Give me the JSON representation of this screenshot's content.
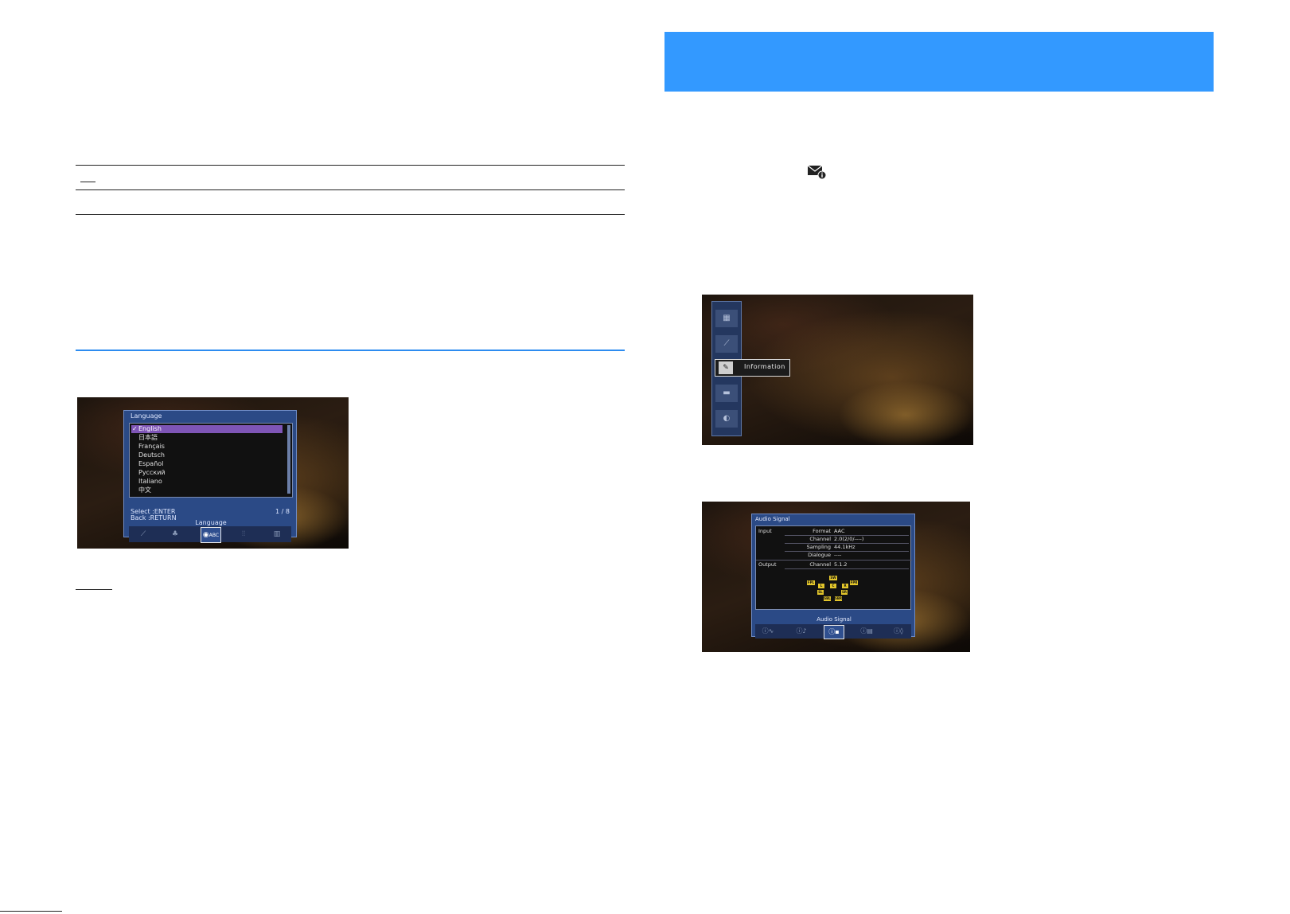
{
  "language_screen": {
    "title": "Language",
    "items": [
      "English",
      "日本語",
      "Français",
      "Deutsch",
      "Español",
      "Русский",
      "Italiano",
      "中文"
    ],
    "selected_index": 0,
    "select_hint": "Select :ENTER",
    "back_hint": "Back :RETURN",
    "page_indicator": "1 / 8",
    "section_label": "Language",
    "icons": [
      "wrench-icon",
      "plant-icon",
      "globe-abc-icon",
      "equalizer-icon",
      "grid-icon"
    ],
    "selected_icon_label": "ABC"
  },
  "info_menu_screen": {
    "popup_label": "Information",
    "icons": [
      "input-icon",
      "guitar-icon",
      "information-icon",
      "speaker-icon",
      "disc-icon"
    ]
  },
  "audio_signal_screen": {
    "title": "Audio Signal",
    "input_label": "Input",
    "output_label": "Output",
    "rows": [
      {
        "field": "Format",
        "value": "AAC"
      },
      {
        "field": "Channel",
        "value": "2.0(2/0/----)"
      },
      {
        "field": "Sampling",
        "value": "44.1kHz"
      },
      {
        "field": "Dialogue",
        "value": "----"
      }
    ],
    "output_row": {
      "field": "Channel",
      "value": "5.1.2"
    },
    "speakers": [
      "FPL",
      "SW",
      "FPR",
      "L",
      "C",
      "R",
      "SL",
      "SR",
      "SBL",
      "SBR"
    ],
    "footer_label": "Audio Signal",
    "icons": [
      "info-input-icon",
      "info-dsp-icon",
      "info-audio-icon",
      "info-video-icon",
      "info-zone-icon"
    ]
  },
  "colors": {
    "header_bar": "#3399ff",
    "blue_rule": "#2d8cf0",
    "dialog_blue": "#2b4a86",
    "selected_item": "#7e55b6",
    "speaker_yellow": "#e3c62b"
  }
}
